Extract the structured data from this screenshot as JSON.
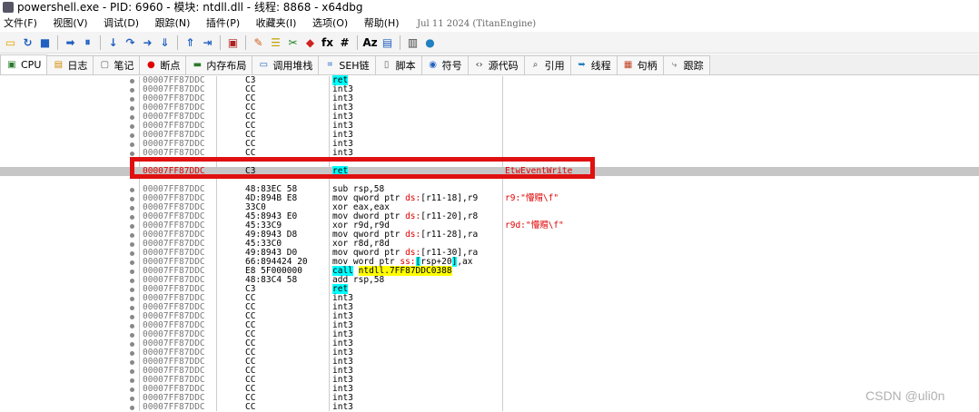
{
  "window": {
    "title": "powershell.exe - PID: 6960 - 模块: ntdll.dll - 线程: 8868 - x64dbg"
  },
  "menu": {
    "items": [
      "文件(F)",
      "视图(V)",
      "调试(D)",
      "跟踪(N)",
      "插件(P)",
      "收藏夹(I)",
      "选项(O)",
      "帮助(H)"
    ],
    "status": "Jul 11 2024 (TitanEngine)"
  },
  "toolbar": {
    "buttons": [
      {
        "name": "open-icon",
        "glyph": "▭",
        "color": "#e8a000"
      },
      {
        "name": "restart-icon",
        "glyph": "↻",
        "color": "#2060c0"
      },
      {
        "name": "stop-icon",
        "glyph": "■",
        "color": "#2060c0"
      },
      {
        "name": "run-icon",
        "glyph": "➡",
        "color": "#2060c0"
      },
      {
        "name": "pause-icon",
        "glyph": "⏸",
        "color": "#2060c0"
      },
      {
        "name": "step-into-icon",
        "glyph": "↓",
        "color": "#2060c0"
      },
      {
        "name": "step-over-icon",
        "glyph": "↷",
        "color": "#2060c0"
      },
      {
        "name": "trace-into-icon",
        "glyph": "➜",
        "color": "#2060c0"
      },
      {
        "name": "trace-over-icon",
        "glyph": "⇓",
        "color": "#2060c0"
      },
      {
        "name": "execute-till-return-icon",
        "glyph": "⇑",
        "color": "#2060c0"
      },
      {
        "name": "run-to-user-code-icon",
        "glyph": "⇥",
        "color": "#2060c0"
      },
      {
        "name": "scylla-icon",
        "glyph": "▣",
        "color": "#b02020"
      },
      {
        "name": "patch-icon",
        "glyph": "✎",
        "color": "#d06020"
      },
      {
        "name": "comment-icon",
        "glyph": "☰",
        "color": "#c0a000"
      },
      {
        "name": "label-icon",
        "glyph": "✂",
        "color": "#208020"
      },
      {
        "name": "bookmark-icon",
        "glyph": "◆",
        "color": "#d02020"
      },
      {
        "name": "function-icon",
        "glyph": "fx",
        "color": "#000000"
      },
      {
        "name": "hash-icon",
        "glyph": "#",
        "color": "#000000"
      },
      {
        "name": "strings-icon",
        "glyph": "Az",
        "color": "#000000"
      },
      {
        "name": "modules-icon",
        "glyph": "▤",
        "color": "#2060c0"
      },
      {
        "name": "memory-icon",
        "glyph": "▥",
        "color": "#404040"
      },
      {
        "name": "graph-icon",
        "glyph": "●",
        "color": "#2080c0"
      }
    ]
  },
  "tabs": [
    {
      "label": "CPU",
      "icon": "cpu-icon"
    },
    {
      "label": "日志",
      "icon": "log-icon"
    },
    {
      "label": "笔记",
      "icon": "notes-icon"
    },
    {
      "label": "断点",
      "icon": "breakpoint-icon"
    },
    {
      "label": "内存布局",
      "icon": "memory-map-icon"
    },
    {
      "label": "调用堆栈",
      "icon": "call-stack-icon"
    },
    {
      "label": "SEH链",
      "icon": "seh-icon"
    },
    {
      "label": "脚本",
      "icon": "script-icon"
    },
    {
      "label": "符号",
      "icon": "symbols-icon"
    },
    {
      "label": "源代码",
      "icon": "source-icon"
    },
    {
      "label": "引用",
      "icon": "references-icon"
    },
    {
      "label": "线程",
      "icon": "threads-icon"
    },
    {
      "label": "句柄",
      "icon": "handles-icon"
    },
    {
      "label": "跟踪",
      "icon": "trace-icon"
    }
  ],
  "disassembly": [
    {
      "addr": "00007FF87DDC",
      "bytes": "C3",
      "instr": "ret",
      "cmt": ""
    },
    {
      "addr": "00007FF87DDC",
      "bytes": "CC",
      "instr": "int3",
      "cmt": ""
    },
    {
      "addr": "00007FF87DDC",
      "bytes": "CC",
      "instr": "int3",
      "cmt": ""
    },
    {
      "addr": "00007FF87DDC",
      "bytes": "CC",
      "instr": "int3",
      "cmt": ""
    },
    {
      "addr": "00007FF87DDC",
      "bytes": "CC",
      "instr": "int3",
      "cmt": ""
    },
    {
      "addr": "00007FF87DDC",
      "bytes": "CC",
      "instr": "int3",
      "cmt": ""
    },
    {
      "addr": "00007FF87DDC",
      "bytes": "CC",
      "instr": "int3",
      "cmt": ""
    },
    {
      "addr": "00007FF87DDC",
      "bytes": "CC",
      "instr": "int3",
      "cmt": ""
    },
    {
      "addr": "00007FF87DDC",
      "bytes": "CC",
      "instr": "int3",
      "cmt": ""
    },
    {
      "addr": "",
      "bytes": "",
      "instr": "",
      "cmt": ""
    },
    {
      "addr": "00007FF87DDC",
      "bytes": "C3",
      "instr": "ret",
      "cmt": "EtwEventWrite"
    },
    {
      "addr": "",
      "bytes": "",
      "instr": "",
      "cmt": ""
    },
    {
      "addr": "00007FF87DDC",
      "bytes": "48:83EC 58",
      "instr": "sub rsp,58",
      "cmt": ""
    },
    {
      "addr": "00007FF87DDC",
      "bytes": "4D:894B E8",
      "instr": "mov qword ptr ds:[r11-18],r9",
      "cmt": "r9:\"懵赗\\f\""
    },
    {
      "addr": "00007FF87DDC",
      "bytes": "33C0",
      "instr": "xor eax,eax",
      "cmt": ""
    },
    {
      "addr": "00007FF87DDC",
      "bytes": "45:8943 E0",
      "instr": "mov dword ptr ds:[r11-20],r8",
      "cmt": ""
    },
    {
      "addr": "00007FF87DDC",
      "bytes": "45:33C9",
      "instr": "xor r9d,r9d",
      "cmt": "r9d:\"懵赗\\f\""
    },
    {
      "addr": "00007FF87DDC",
      "bytes": "49:8943 D8",
      "instr": "mov qword ptr ds:[r11-28],ra",
      "cmt": ""
    },
    {
      "addr": "00007FF87DDC",
      "bytes": "45:33C0",
      "instr": "xor r8d,r8d",
      "cmt": ""
    },
    {
      "addr": "00007FF87DDC",
      "bytes": "49:8943 D0",
      "instr": "mov qword ptr ds:[r11-30],ra",
      "cmt": ""
    },
    {
      "addr": "00007FF87DDC",
      "bytes": "66:894424 20",
      "instr": "mov word ptr ss:[rsp+20],ax",
      "cmt": ""
    },
    {
      "addr": "00007FF87DDC",
      "bytes": "E8 5F000000",
      "instr": "call ntdll.7FF87DDC0388",
      "cmt": ""
    },
    {
      "addr": "00007FF87DDC",
      "bytes": "48:83C4 58",
      "instr": "add rsp,58",
      "cmt": ""
    },
    {
      "addr": "00007FF87DDC",
      "bytes": "C3",
      "instr": "ret",
      "cmt": ""
    },
    {
      "addr": "00007FF87DDC",
      "bytes": "CC",
      "instr": "int3",
      "cmt": ""
    },
    {
      "addr": "00007FF87DDC",
      "bytes": "CC",
      "instr": "int3",
      "cmt": ""
    },
    {
      "addr": "00007FF87DDC",
      "bytes": "CC",
      "instr": "int3",
      "cmt": ""
    },
    {
      "addr": "00007FF87DDC",
      "bytes": "CC",
      "instr": "int3",
      "cmt": ""
    },
    {
      "addr": "00007FF87DDC",
      "bytes": "CC",
      "instr": "int3",
      "cmt": ""
    },
    {
      "addr": "00007FF87DDC",
      "bytes": "CC",
      "instr": "int3",
      "cmt": ""
    },
    {
      "addr": "00007FF87DDC",
      "bytes": "CC",
      "instr": "int3",
      "cmt": ""
    },
    {
      "addr": "00007FF87DDC",
      "bytes": "CC",
      "instr": "int3",
      "cmt": ""
    },
    {
      "addr": "00007FF87DDC",
      "bytes": "CC",
      "instr": "int3",
      "cmt": ""
    },
    {
      "addr": "00007FF87DDC",
      "bytes": "CC",
      "instr": "int3",
      "cmt": ""
    },
    {
      "addr": "00007FF87DDC",
      "bytes": "CC",
      "instr": "int3",
      "cmt": ""
    },
    {
      "addr": "00007FF87DDC",
      "bytes": "CC",
      "instr": "int3",
      "cmt": ""
    },
    {
      "addr": "00007FF87DDC",
      "bytes": "CC",
      "instr": "int3",
      "cmt": ""
    }
  ],
  "watermark": "CSDN @uli0n",
  "colors": {
    "selected_row": "#c6c6c6",
    "highlight_box": "#e01010",
    "ret_highlight": "#00ffff",
    "call_highlight": "#ffff00",
    "segment_register": "#e00000"
  }
}
